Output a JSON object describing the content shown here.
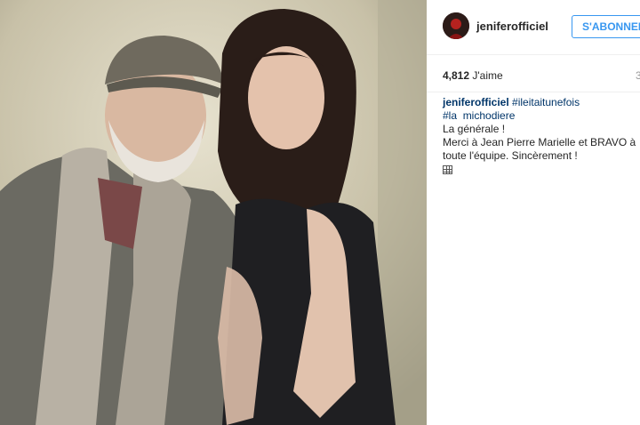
{
  "post": {
    "image_alt": "",
    "username": "jeniferofficiel",
    "follow_label": "S'ABONNER",
    "likes_count": "4,812",
    "likes_label": "J'aime",
    "time_ago": "3",
    "caption": {
      "username": "jeniferofficiel",
      "hashtag_1": "#ileitaitunefois",
      "hashtag_2": "#la",
      "mention": "michodiere",
      "line_1": "La générale !",
      "line_2": "Merci à Jean Pierre Marielle et BRAVO à",
      "line_3": "toute l'équipe. Sincèrement !",
      "emoji": "calendar-emoji"
    }
  },
  "colors": {
    "link": "#003569",
    "follow_blue": "#3897f0",
    "divider": "#efefef"
  }
}
